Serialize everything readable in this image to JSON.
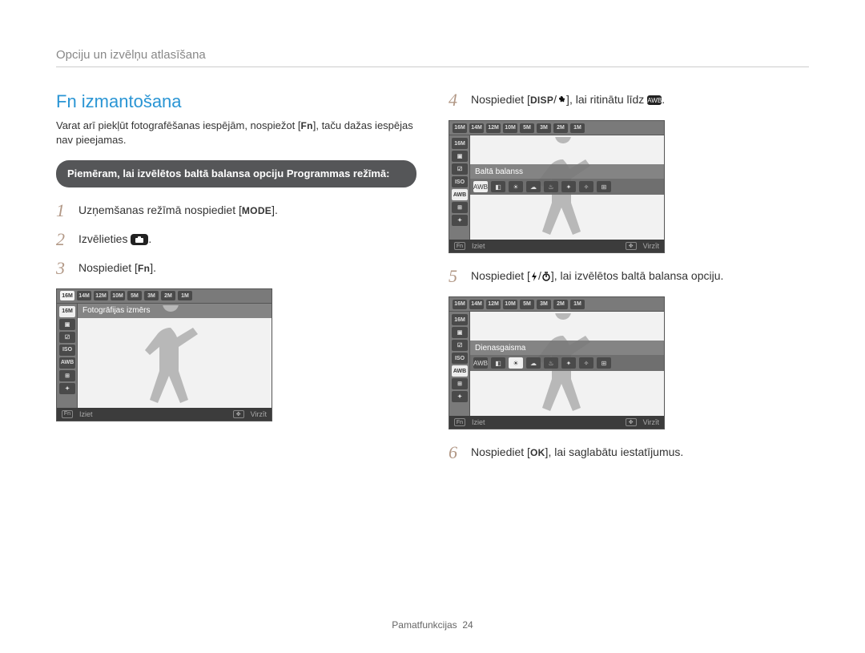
{
  "breadcrumb": "Opciju un izvēlņu atlasīšana",
  "section_title": "Fn izmantošana",
  "intro_before": "Varat arī piekļūt fotografēšanas iespējām, nospiežot ",
  "intro_fn": "Fn",
  "intro_after": ", taču dažas iespējas nav pieejamas.",
  "pill": "Piemēram, lai izvēlētos baltā balansa opciju Programmas režīmā:",
  "steps_left": [
    {
      "num": "1",
      "before": "Uzņemšanas režīmā nospiediet ",
      "kbd": "MODE",
      "after": "."
    },
    {
      "num": "2",
      "before": "Izvēlieties ",
      "icon": "Op",
      "after": "."
    },
    {
      "num": "3",
      "before": "Nospiediet ",
      "kbd": "Fn",
      "after": "."
    }
  ],
  "steps_right": [
    {
      "num": "4",
      "before": "Nospiediet ",
      "kbd": "DISP",
      "mid": "/",
      "icon": "flower-icon",
      "after": ", lai ritinātu līdz ",
      "trailing_icon": "AWB",
      "end": "."
    },
    {
      "num": "5",
      "before": "Nospiediet ",
      "icon1": "flash-icon",
      "mid": "/",
      "icon2": "timer-icon",
      "after": ", lai izvēlētos baltā balansa opciju."
    },
    {
      "num": "6",
      "before": "Nospiediet ",
      "kbd": "OK",
      "after": ", lai saglabātu iestatījumus."
    }
  ],
  "lcd_shared": {
    "exit": "Iziet",
    "move": "Virzīt",
    "fn": "Fn",
    "side_icons": [
      "16M",
      "▣",
      "☑",
      "ISO",
      "AWB",
      "⊞",
      "✦"
    ],
    "top_icons": [
      "16M",
      "14M",
      "12M",
      "10M",
      "5M",
      "3M",
      "2M",
      "1M"
    ],
    "wb_icons": [
      "AWB",
      "◧",
      "☀",
      "☁",
      "♨",
      "✦",
      "✧",
      "⊞"
    ]
  },
  "lcd1": {
    "label": "Fotogrāfijas izmērs",
    "selected_side": 0
  },
  "lcd2": {
    "label": "Baltā balanss",
    "selected_side": 4,
    "selected_band": 0
  },
  "lcd3": {
    "label": "Dienasgaisma",
    "selected_side": 4,
    "selected_band": 2
  },
  "footer": {
    "label": "Pamatfunkcijas",
    "page": "24"
  }
}
